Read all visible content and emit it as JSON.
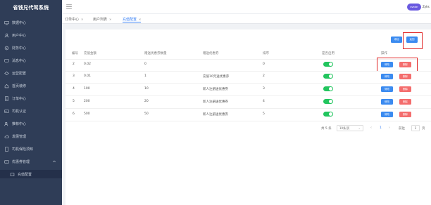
{
  "app": {
    "title": "省钱兄代驾系统"
  },
  "sidebar": {
    "items": [
      {
        "label": "数据中心",
        "icon": "monitor-icon"
      },
      {
        "label": "用户中心",
        "icon": "user-icon"
      },
      {
        "label": "财务中心",
        "icon": "finance-icon"
      },
      {
        "label": "消息中心",
        "icon": "message-icon"
      },
      {
        "label": "运营配置",
        "icon": "settings-icon"
      },
      {
        "label": "首页装修",
        "icon": "home-icon"
      },
      {
        "label": "订单中心",
        "icon": "order-icon"
      },
      {
        "label": "司机认证",
        "icon": "id-card-icon"
      },
      {
        "label": "推荐中心",
        "icon": "share-user-icon"
      },
      {
        "label": "发展管理",
        "icon": "cloud-icon"
      },
      {
        "label": "司机保险须知",
        "icon": "document-icon"
      },
      {
        "label": "优惠券管理",
        "icon": "coupon-icon"
      }
    ],
    "sub_items": [
      {
        "label": "充值配置",
        "icon": "folder-icon"
      }
    ]
  },
  "header": {
    "avatar_text": "avatar",
    "username": "Zyhs"
  },
  "tabs": [
    {
      "label": "订单中心"
    },
    {
      "label": "用户列表"
    },
    {
      "label": "充值配置"
    }
  ],
  "toolbar": {
    "add_label": "添加",
    "back_label": "返回"
  },
  "table": {
    "columns": [
      "编号",
      "充值金额",
      "赠送优惠券数量",
      "赠送优惠券",
      "排序",
      "是否启用",
      "操作"
    ],
    "rows": [
      {
        "id": "2",
        "amount": "0.02",
        "coupon_count": "0",
        "coupon": "",
        "sort": "0",
        "enabled": true
      },
      {
        "id": "3",
        "amount": "0.01",
        "coupon_count": "1",
        "coupon": "充值10元送优惠券",
        "sort": "2",
        "enabled": true
      },
      {
        "id": "4",
        "amount": "100",
        "coupon_count": "10",
        "coupon": "新人注册送优惠券",
        "sort": "3",
        "enabled": true
      },
      {
        "id": "5",
        "amount": "200",
        "coupon_count": "20",
        "coupon": "新人注册送优惠券",
        "sort": "4",
        "enabled": true
      },
      {
        "id": "6",
        "amount": "500",
        "coupon_count": "50",
        "coupon": "新人注册送优惠券",
        "sort": "5",
        "enabled": true
      }
    ],
    "edit_label": "修改",
    "delete_label": "删除"
  },
  "pagination": {
    "total_text": "共 5 条",
    "page_size": "10条/页",
    "current_page": "1",
    "goto_label": "前往",
    "goto_value": "1",
    "page_suffix": "页"
  }
}
